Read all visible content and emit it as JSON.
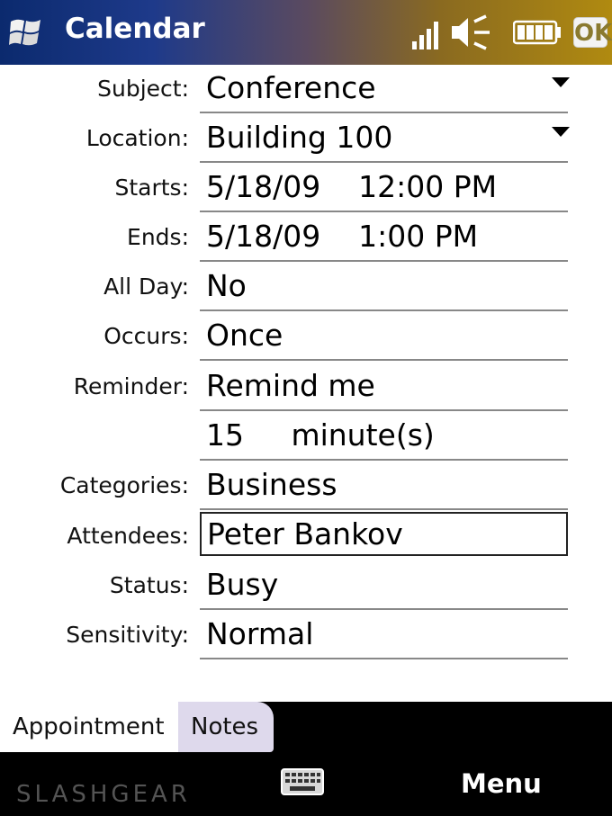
{
  "titlebar": {
    "title": "Calendar",
    "ok_label": "OK",
    "icons": [
      "windows-start-icon",
      "signal-icon",
      "speaker-muted-icon",
      "battery-icon"
    ]
  },
  "form": {
    "subject": {
      "label": "Subject:",
      "value": "Conference"
    },
    "location": {
      "label": "Location:",
      "value": "Building 100"
    },
    "starts": {
      "label": "Starts:",
      "value": "5/18/09    12:00 PM"
    },
    "ends": {
      "label": "Ends:",
      "value": "5/18/09    1:00 PM"
    },
    "all_day": {
      "label": "All Day:",
      "value": "No"
    },
    "occurs": {
      "label": "Occurs:",
      "value": "Once"
    },
    "reminder": {
      "label": "Reminder:",
      "value": "Remind me"
    },
    "reminder_time": {
      "value": "15     minute(s)"
    },
    "categories": {
      "label": "Categories:",
      "value": "Business"
    },
    "attendees": {
      "label": "Attendees:",
      "value": "Peter Bankov"
    },
    "status": {
      "label": "Status:",
      "value": "Busy"
    },
    "sensitivity": {
      "label": "Sensitivity:",
      "value": "Normal"
    }
  },
  "tabs": [
    {
      "label": "Appointment",
      "selected": true
    },
    {
      "label": "Notes",
      "selected": false
    }
  ],
  "softkeys": {
    "right": "Menu"
  },
  "watermark": "SLASHGEAR",
  "colors": {
    "notes_tab": "#ded9ec",
    "softbar": "#000000"
  }
}
